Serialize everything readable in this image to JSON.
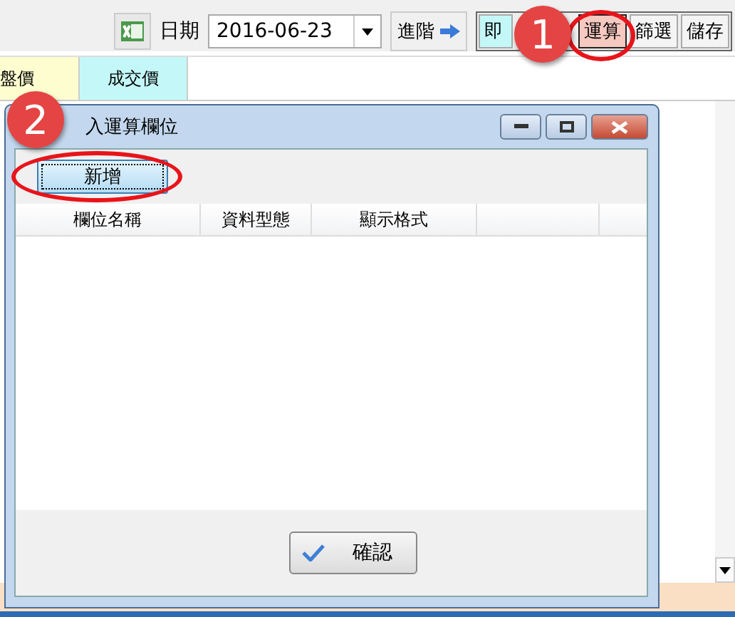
{
  "toolbar": {
    "date_label": "日期",
    "date_value": "2016-06-23",
    "advanced_label": "進階",
    "buttons": [
      {
        "label": "即",
        "highlighted": false
      },
      {
        "label": "運算",
        "highlighted": true
      },
      {
        "label": "篩選",
        "highlighted": false
      },
      {
        "label": "儲存",
        "highlighted": false
      }
    ]
  },
  "columns": [
    {
      "label": "盤價",
      "color": "#fdfdd0"
    },
    {
      "label": "成交價",
      "color": "#c4f8f8"
    }
  ],
  "dialog": {
    "title": "入運算欄位",
    "add_button": "新增",
    "table_columns": [
      "欄位名稱",
      "資料型態",
      "顯示格式",
      ""
    ],
    "confirm_button": "確認"
  },
  "callouts": [
    {
      "number": "1"
    },
    {
      "number": "2"
    }
  ]
}
